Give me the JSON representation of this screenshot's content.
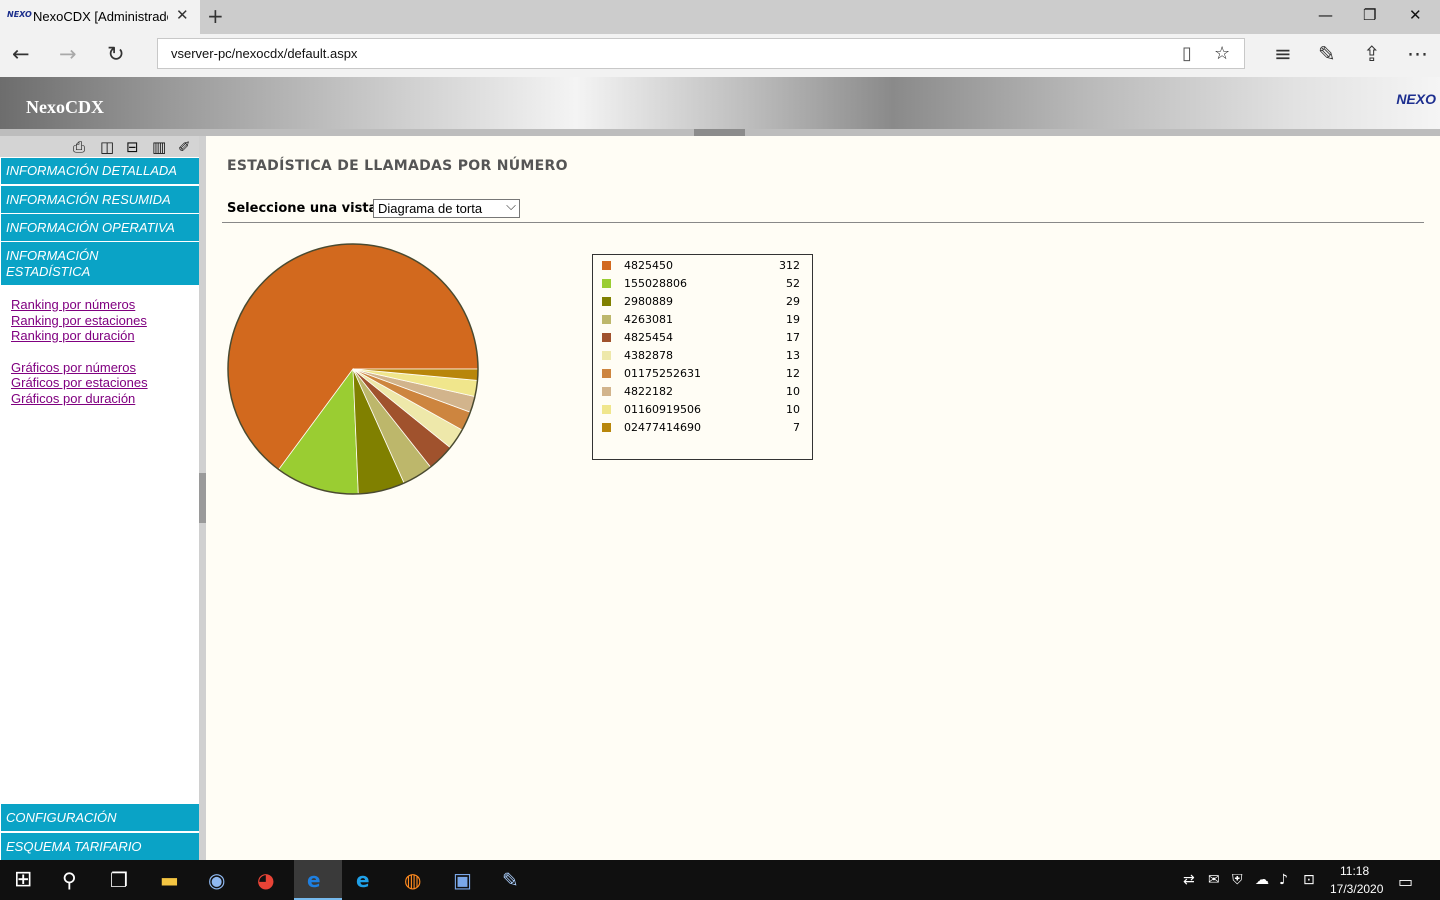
{
  "browser": {
    "tab_title": "NexoCDX [Administrador]",
    "tab_favicon_text": "NEXO",
    "url": "vserver-pc/nexocdx/default.aspx"
  },
  "app": {
    "title": "NexoCDX",
    "logo_text": "NEXO"
  },
  "menu": {
    "items": [
      {
        "label": "INFORMACIÓN DETALLADA"
      },
      {
        "label": "INFORMACIÓN RESUMIDA"
      },
      {
        "label": "INFORMACIÓN OPERATIVA"
      },
      {
        "label": "INFORMACIÓN ESTADÍSTICA"
      }
    ],
    "sublinks_ranking": [
      "Ranking por números",
      "Ranking por estaciones",
      "Ranking por duración"
    ],
    "sublinks_graficos": [
      "Gráficos por números",
      "Gráficos por estaciones",
      "Gráficos por duración"
    ],
    "bottom_items": [
      {
        "label": "CONFIGURACIÓN"
      },
      {
        "label": "ESQUEMA TARIFARIO"
      }
    ]
  },
  "main": {
    "title": "ESTADÍSTICA DE LLAMADAS POR NÚMERO",
    "view_label": "Seleccione una vista:",
    "view_selected": "Diagrama de torta"
  },
  "chart_data": {
    "type": "pie",
    "categories": [
      "4825450",
      "155028806",
      "2980889",
      "4263081",
      "4825454",
      "4382878",
      "01175252631",
      "4822182",
      "01160919506",
      "02477414690"
    ],
    "values": [
      312,
      52,
      29,
      19,
      17,
      13,
      12,
      10,
      10,
      7
    ],
    "colors": [
      "#d2691e",
      "#9acd32",
      "#808000",
      "#bdb76b",
      "#a0522d",
      "#eee8aa",
      "#cd853f",
      "#d2b48c",
      "#f0e68c",
      "#b8860b"
    ],
    "legend": "right"
  },
  "taskbar": {
    "time": "11:18",
    "date": "17/3/2020"
  }
}
